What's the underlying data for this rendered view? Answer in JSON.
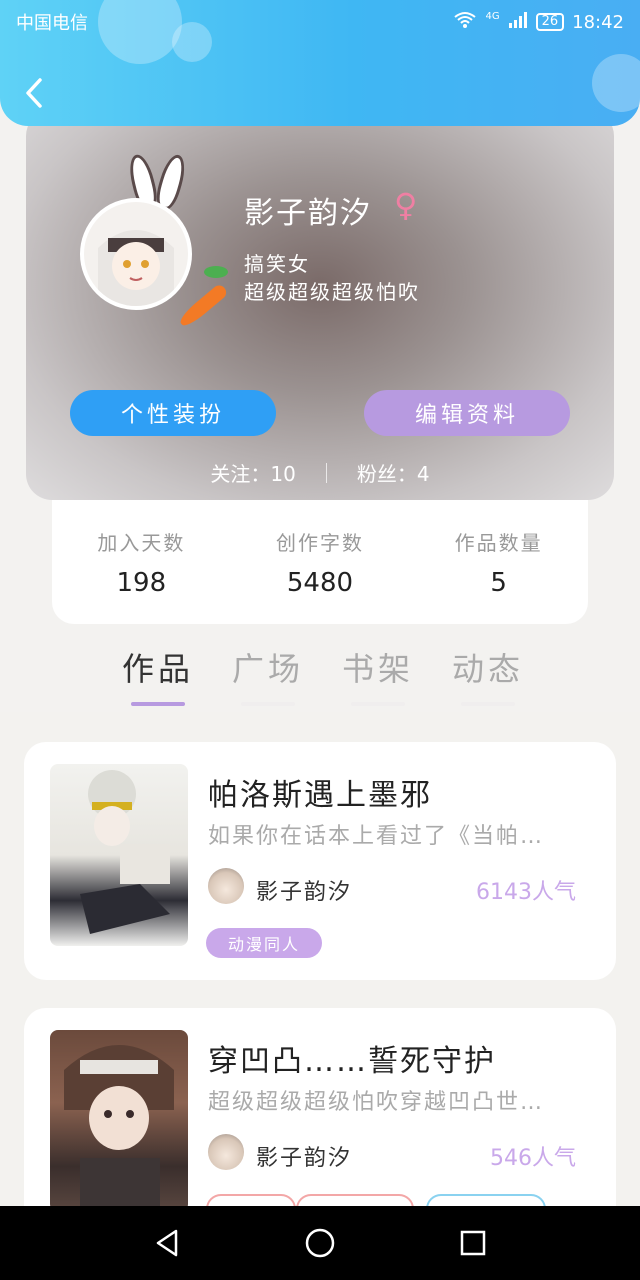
{
  "status_bar": {
    "carrier": "中国电信",
    "network": "4G",
    "battery": "26",
    "time": "18:42"
  },
  "profile": {
    "username": "影子韵汐",
    "gender_symbol": "♀",
    "bio_line1": "搞笑女",
    "bio_line2": "超级超级超级怕吹",
    "skin_button": "个性装扮",
    "edit_button": "编辑资料",
    "follow_label": "关注：",
    "follow_count": "10",
    "fans_label": "粉丝：",
    "fans_count": "4"
  },
  "stats": [
    {
      "label": "加入天数",
      "value": "198"
    },
    {
      "label": "创作字数",
      "value": "5480"
    },
    {
      "label": "作品数量",
      "value": "5"
    }
  ],
  "tabs": [
    {
      "label": "作品",
      "active": true
    },
    {
      "label": "广场",
      "active": false
    },
    {
      "label": "书架",
      "active": false
    },
    {
      "label": "动态",
      "active": false
    }
  ],
  "works": [
    {
      "title": "帕洛斯遇上墨邪",
      "description": "如果你在话本上看过了《当帕…",
      "author": "影子韵汐",
      "popularity": "6143人气",
      "tag": "动漫同人"
    },
    {
      "title": "穿凹凸……誓死守护",
      "description": "超级超级超级怕吹穿越凹凸世…",
      "author": "影子韵汐",
      "popularity": "546人气"
    }
  ],
  "colors": {
    "header": "#3fb7f3",
    "skin_button": "#2f9ff5",
    "edit_button": "#b79ae0",
    "accent_purple": "#c9a8ea",
    "gender_pink": "#ef7fa3"
  }
}
